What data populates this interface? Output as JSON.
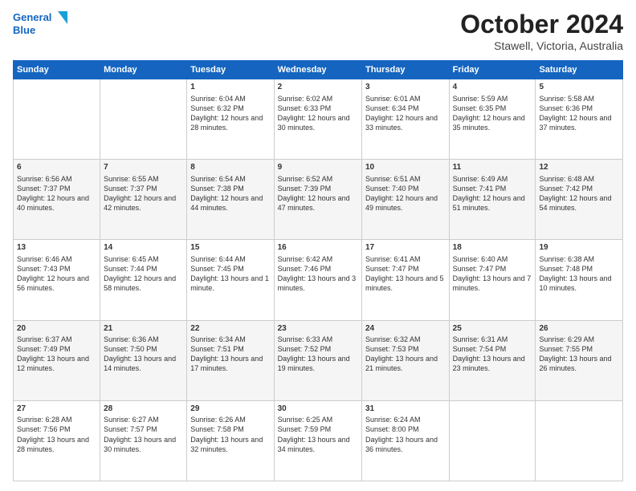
{
  "header": {
    "logo_line1": "General",
    "logo_line2": "Blue",
    "title": "October 2024",
    "subtitle": "Stawell, Victoria, Australia"
  },
  "days_of_week": [
    "Sunday",
    "Monday",
    "Tuesday",
    "Wednesday",
    "Thursday",
    "Friday",
    "Saturday"
  ],
  "weeks": [
    [
      {
        "day": "",
        "info": ""
      },
      {
        "day": "",
        "info": ""
      },
      {
        "day": "1",
        "info": "Sunrise: 6:04 AM\nSunset: 6:32 PM\nDaylight: 12 hours and 28 minutes."
      },
      {
        "day": "2",
        "info": "Sunrise: 6:02 AM\nSunset: 6:33 PM\nDaylight: 12 hours and 30 minutes."
      },
      {
        "day": "3",
        "info": "Sunrise: 6:01 AM\nSunset: 6:34 PM\nDaylight: 12 hours and 33 minutes."
      },
      {
        "day": "4",
        "info": "Sunrise: 5:59 AM\nSunset: 6:35 PM\nDaylight: 12 hours and 35 minutes."
      },
      {
        "day": "5",
        "info": "Sunrise: 5:58 AM\nSunset: 6:36 PM\nDaylight: 12 hours and 37 minutes."
      }
    ],
    [
      {
        "day": "6",
        "info": "Sunrise: 6:56 AM\nSunset: 7:37 PM\nDaylight: 12 hours and 40 minutes."
      },
      {
        "day": "7",
        "info": "Sunrise: 6:55 AM\nSunset: 7:37 PM\nDaylight: 12 hours and 42 minutes."
      },
      {
        "day": "8",
        "info": "Sunrise: 6:54 AM\nSunset: 7:38 PM\nDaylight: 12 hours and 44 minutes."
      },
      {
        "day": "9",
        "info": "Sunrise: 6:52 AM\nSunset: 7:39 PM\nDaylight: 12 hours and 47 minutes."
      },
      {
        "day": "10",
        "info": "Sunrise: 6:51 AM\nSunset: 7:40 PM\nDaylight: 12 hours and 49 minutes."
      },
      {
        "day": "11",
        "info": "Sunrise: 6:49 AM\nSunset: 7:41 PM\nDaylight: 12 hours and 51 minutes."
      },
      {
        "day": "12",
        "info": "Sunrise: 6:48 AM\nSunset: 7:42 PM\nDaylight: 12 hours and 54 minutes."
      }
    ],
    [
      {
        "day": "13",
        "info": "Sunrise: 6:46 AM\nSunset: 7:43 PM\nDaylight: 12 hours and 56 minutes."
      },
      {
        "day": "14",
        "info": "Sunrise: 6:45 AM\nSunset: 7:44 PM\nDaylight: 12 hours and 58 minutes."
      },
      {
        "day": "15",
        "info": "Sunrise: 6:44 AM\nSunset: 7:45 PM\nDaylight: 13 hours and 1 minute."
      },
      {
        "day": "16",
        "info": "Sunrise: 6:42 AM\nSunset: 7:46 PM\nDaylight: 13 hours and 3 minutes."
      },
      {
        "day": "17",
        "info": "Sunrise: 6:41 AM\nSunset: 7:47 PM\nDaylight: 13 hours and 5 minutes."
      },
      {
        "day": "18",
        "info": "Sunrise: 6:40 AM\nSunset: 7:47 PM\nDaylight: 13 hours and 7 minutes."
      },
      {
        "day": "19",
        "info": "Sunrise: 6:38 AM\nSunset: 7:48 PM\nDaylight: 13 hours and 10 minutes."
      }
    ],
    [
      {
        "day": "20",
        "info": "Sunrise: 6:37 AM\nSunset: 7:49 PM\nDaylight: 13 hours and 12 minutes."
      },
      {
        "day": "21",
        "info": "Sunrise: 6:36 AM\nSunset: 7:50 PM\nDaylight: 13 hours and 14 minutes."
      },
      {
        "day": "22",
        "info": "Sunrise: 6:34 AM\nSunset: 7:51 PM\nDaylight: 13 hours and 17 minutes."
      },
      {
        "day": "23",
        "info": "Sunrise: 6:33 AM\nSunset: 7:52 PM\nDaylight: 13 hours and 19 minutes."
      },
      {
        "day": "24",
        "info": "Sunrise: 6:32 AM\nSunset: 7:53 PM\nDaylight: 13 hours and 21 minutes."
      },
      {
        "day": "25",
        "info": "Sunrise: 6:31 AM\nSunset: 7:54 PM\nDaylight: 13 hours and 23 minutes."
      },
      {
        "day": "26",
        "info": "Sunrise: 6:29 AM\nSunset: 7:55 PM\nDaylight: 13 hours and 26 minutes."
      }
    ],
    [
      {
        "day": "27",
        "info": "Sunrise: 6:28 AM\nSunset: 7:56 PM\nDaylight: 13 hours and 28 minutes."
      },
      {
        "day": "28",
        "info": "Sunrise: 6:27 AM\nSunset: 7:57 PM\nDaylight: 13 hours and 30 minutes."
      },
      {
        "day": "29",
        "info": "Sunrise: 6:26 AM\nSunset: 7:58 PM\nDaylight: 13 hours and 32 minutes."
      },
      {
        "day": "30",
        "info": "Sunrise: 6:25 AM\nSunset: 7:59 PM\nDaylight: 13 hours and 34 minutes."
      },
      {
        "day": "31",
        "info": "Sunrise: 6:24 AM\nSunset: 8:00 PM\nDaylight: 13 hours and 36 minutes."
      },
      {
        "day": "",
        "info": ""
      },
      {
        "day": "",
        "info": ""
      }
    ]
  ]
}
